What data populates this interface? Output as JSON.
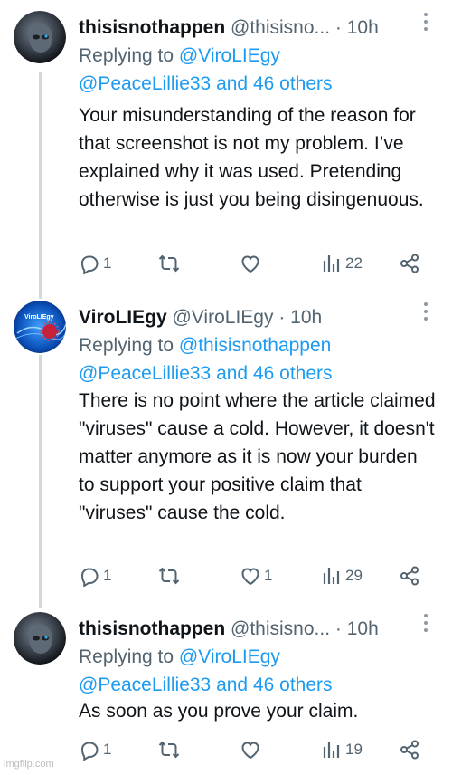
{
  "tweets": [
    {
      "name": "thisisnothappen",
      "handle": "@thisisno...",
      "time": "10h",
      "replying_prefix": "Replying to",
      "reply_user": "@ViroLIEgy",
      "reply_others": "@PeaceLillie33 and 46 others",
      "text": "Your misunderstanding of the reason for that screenshot is not my problem. I’ve explained why it was used. Pretending otherwise is just you being disingenuous.",
      "replies": "1",
      "likes": "",
      "views": "22",
      "avatar": "alien-dark-avatar"
    },
    {
      "name": "ViroLIEgy",
      "handle": "@ViroLIEgy",
      "time": "10h",
      "replying_prefix": "Replying to",
      "reply_user": "@thisisnothappen",
      "reply_others": "@PeaceLillie33 and 46 others",
      "text": "There is no point where the article claimed \"viruses\" cause a cold. However, it doesn't matter anymore as it is now your burden to support your positive claim that \"viruses\" cause the cold.",
      "replies": "1",
      "likes": "1",
      "views": "29",
      "avatar": "virus-blue-avatar",
      "avatar_text": "ViroLIEgy"
    },
    {
      "name": "thisisnothappen",
      "handle": "@thisisno...",
      "time": "10h",
      "replying_prefix": "Replying to",
      "reply_user": "@ViroLIEgy",
      "reply_others": "@PeaceLillie33 and 46 others",
      "text": "As soon as you prove your claim.",
      "replies": "1",
      "likes": "",
      "views": "19",
      "avatar": "alien-dark-avatar"
    }
  ],
  "watermark": "imgflip.com",
  "colors": {
    "link": "#1d9bf0",
    "muted": "#536471",
    "text": "#0f1419",
    "thread": "#cfd9de"
  }
}
